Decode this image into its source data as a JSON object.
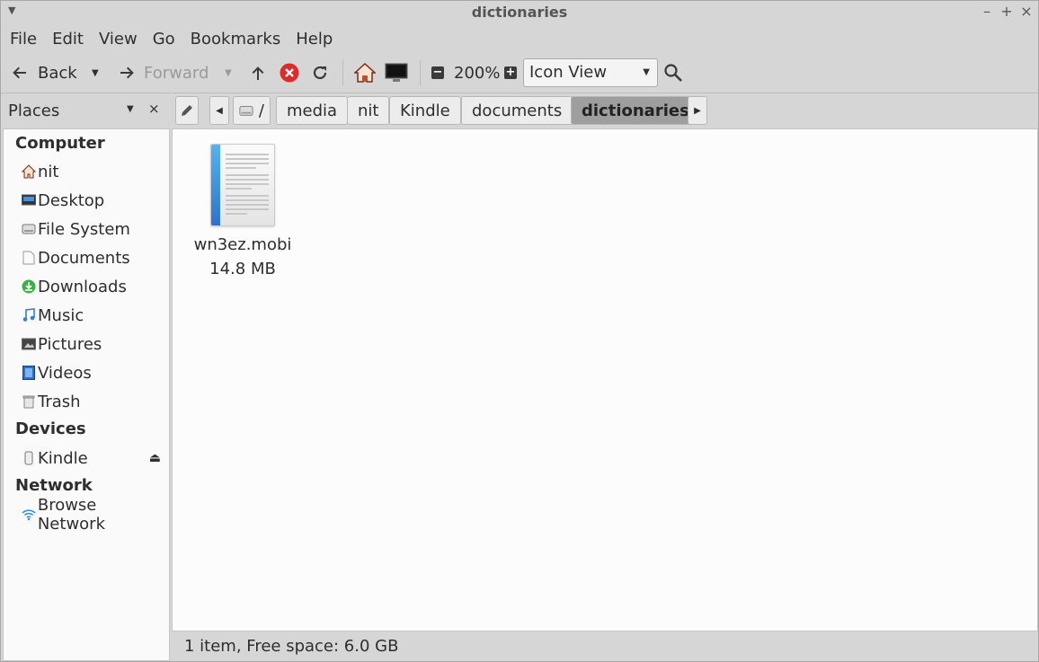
{
  "window": {
    "title": "dictionaries"
  },
  "menubar": {
    "items": [
      "File",
      "Edit",
      "View",
      "Go",
      "Bookmarks",
      "Help"
    ]
  },
  "toolbar": {
    "back_label": "Back",
    "forward_label": "Forward",
    "zoom_level": "200%",
    "view_mode": "Icon View"
  },
  "places": {
    "title": "Places"
  },
  "pathbar": {
    "crumbs": [
      "/",
      "media",
      "nit",
      "Kindle",
      "documents",
      "dictionaries"
    ],
    "active": "dictionaries"
  },
  "sidebar": {
    "computer_heading": "Computer",
    "computer_items": [
      "nit",
      "Desktop",
      "File System",
      "Documents",
      "Downloads",
      "Music",
      "Pictures",
      "Videos",
      "Trash"
    ],
    "devices_heading": "Devices",
    "device_items": [
      "Kindle"
    ],
    "network_heading": "Network",
    "network_items": [
      "Browse Network"
    ]
  },
  "files": [
    {
      "name": "wn3ez.mobi",
      "size": "14.8 MB"
    }
  ],
  "statusbar": {
    "text": "1 item, Free space: 6.0 GB"
  },
  "colors": {
    "active_crumb": "#9e9e9e",
    "stop_button": "#e02a2a",
    "file_spine": "#3a8fe0",
    "downloads_icon": "#3cb043"
  }
}
